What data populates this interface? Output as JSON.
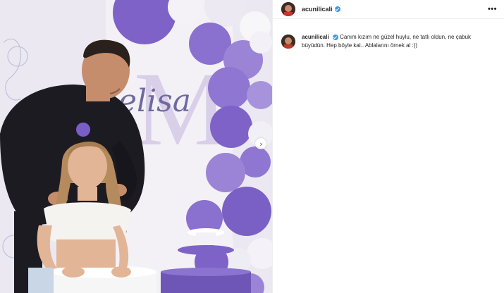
{
  "post": {
    "username": "acunilicali",
    "verified": true,
    "more_icon": "more-horizontal-icon",
    "caption": "Canım kızım ne güzel huylu, ne tatlı oldun, ne çabuk büyüdün. Hep böyle kal.. Ablalarını örnek al :))",
    "backdrop_text": "elisa",
    "backdrop_letter": "M",
    "next_icon": "chevron-right-icon"
  },
  "colors": {
    "balloon_dark": "#7a5fc4",
    "balloon_mid": "#9b84d6",
    "balloon_light": "#f2f0f7",
    "verified_blue": "#3897f0"
  }
}
